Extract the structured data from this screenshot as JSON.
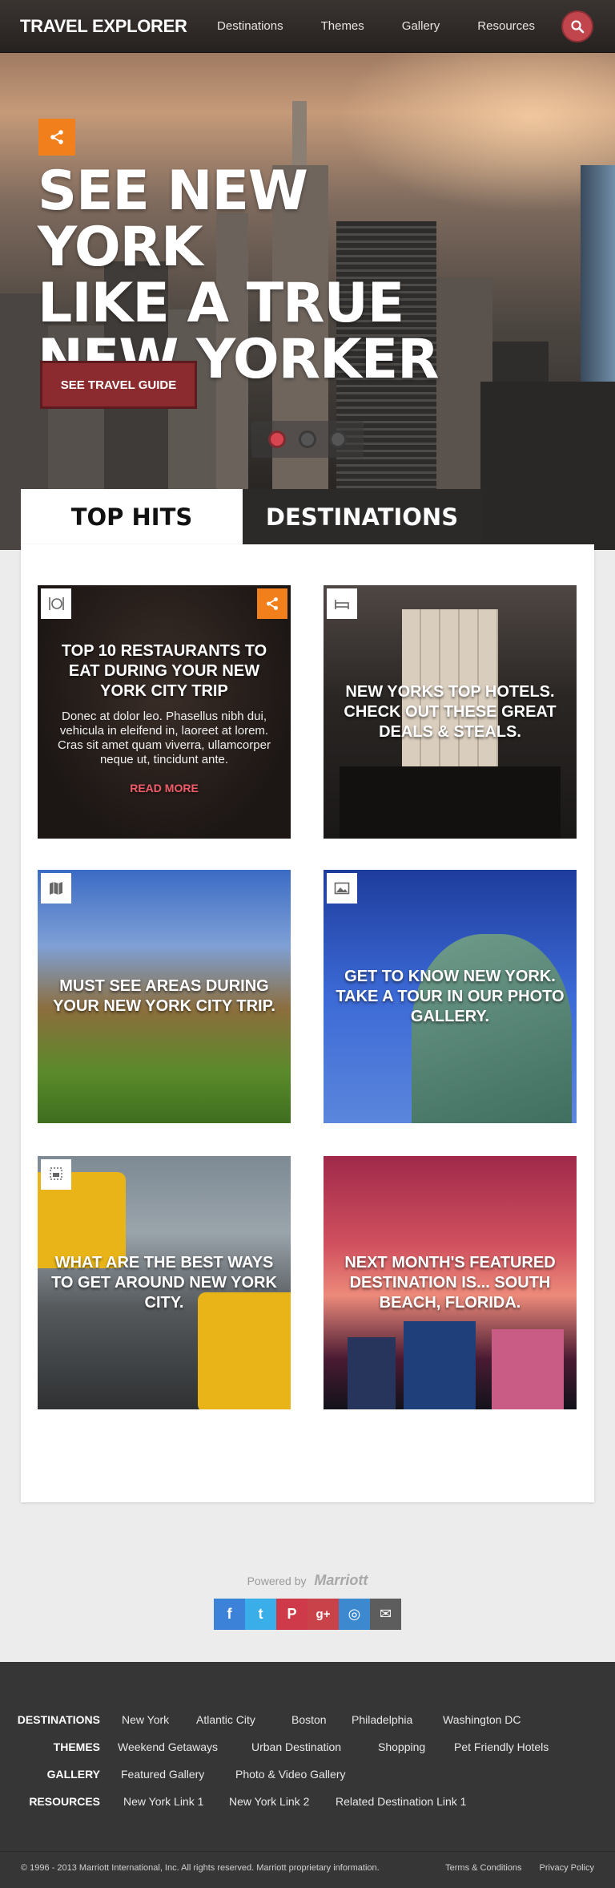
{
  "header": {
    "brand": "TRAVEL EXPLORER",
    "nav": [
      "Destinations",
      "Themes",
      "Gallery",
      "Resources"
    ],
    "search_icon": "search-icon"
  },
  "hero": {
    "title_lines": [
      "SEE NEW YORK",
      "LIKE A TRUE",
      "NEW YORKER"
    ],
    "cta": "SEE TRAVEL GUIDE",
    "slides": 3,
    "active_slide": 1
  },
  "tabs": [
    {
      "label": "TOP HITS",
      "active": true
    },
    {
      "label": "DESTINATIONS",
      "active": false
    }
  ],
  "cards": [
    {
      "icon": "utensils-icon",
      "title": "TOP 10 RESTAURANTS TO EAT DURING YOUR NEW YORK CITY TRIP",
      "body": "Donec at dolor leo. Phasellus nibh dui, vehicula in eleifend in, laoreet at lorem. Cras sit amet quam viverra, ullamcorper neque ut, tincidunt ante.",
      "link": "READ MORE",
      "share": true
    },
    {
      "icon": "bed-icon",
      "title": "NEW YORKS TOP HOTELS. CHECK OUT THESE GREAT DEALS & STEALS."
    },
    {
      "icon": "map-icon",
      "title": "MUST SEE AREAS DURING YOUR NEW YORK CITY TRIP."
    },
    {
      "icon": "photo-icon",
      "title": "GET TO KNOW NEW YORK. TAKE A TOUR IN OUR PHOTO GALLERY."
    },
    {
      "icon": "transport-icon",
      "title": "WHAT ARE THE BEST WAYS TO GET AROUND NEW YORK CITY."
    },
    {
      "icon": "calendar-icon",
      "title": "NEXT MONTH'S FEATURED DESTINATION IS... SOUTH BEACH, FLORIDA."
    }
  ],
  "powered": {
    "label": "Powered by",
    "brand": "Marriott"
  },
  "social": [
    {
      "name": "facebook-icon",
      "glyph": "f",
      "color": "#3b82d8"
    },
    {
      "name": "twitter-icon",
      "glyph": "t",
      "color": "#3aaee8"
    },
    {
      "name": "pinterest-icon",
      "glyph": "P",
      "color": "#cf3a4a"
    },
    {
      "name": "googleplus-icon",
      "glyph": "g+",
      "color": "#c9424a"
    },
    {
      "name": "instagram-icon",
      "glyph": "◎",
      "color": "#3d89d0"
    },
    {
      "name": "mail-icon",
      "glyph": "✉",
      "color": "#5d5d5d"
    }
  ],
  "footer": {
    "rows": [
      {
        "label": "DESTINATIONS",
        "links": [
          "New York",
          "Atlantic City",
          "Boston",
          "Philadelphia",
          "Washington DC"
        ]
      },
      {
        "label": "THEMES",
        "links": [
          "Weekend Getaways",
          "Urban Destination",
          "Shopping",
          "Pet Friendly Hotels"
        ]
      },
      {
        "label": "GALLERY",
        "links": [
          "Featured Gallery",
          "Photo & Video Gallery"
        ]
      },
      {
        "label": "RESOURCES",
        "links": [
          "New York Link 1",
          "New York Link 2",
          "Related Destination Link 1"
        ]
      }
    ],
    "copyright": "© 1996 - 2013 Marriott International, Inc. All rights reserved. Marriott proprietary information.",
    "legal": [
      "Terms & Conditions",
      "Privacy Policy"
    ]
  },
  "colors": {
    "accent": "#f07f1c",
    "brand_red": "#8b2b2f",
    "dark": "#363636"
  }
}
